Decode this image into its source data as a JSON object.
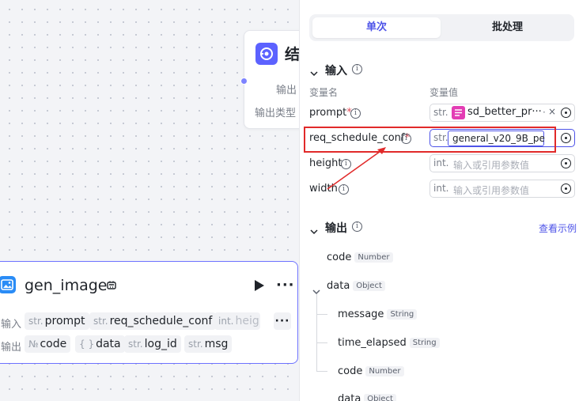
{
  "canvas": {
    "end_node": {
      "title": "结",
      "row1_label": "输出",
      "row2_label": "输出类型"
    },
    "gen_node": {
      "title": "gen_image",
      "more": "···",
      "input_label": "输入",
      "output_label": "输出",
      "inputs": [
        {
          "type": "str.",
          "name": "prompt"
        },
        {
          "type": "str.",
          "name": "req_schedule_conf"
        },
        {
          "type": "int.",
          "name": "heig"
        }
      ],
      "inputs_more": "···",
      "outputs": [
        {
          "type": "№",
          "name": "code"
        },
        {
          "type": "{ }",
          "name": "data"
        },
        {
          "type": "str.",
          "name": "log_id"
        },
        {
          "type": "str.",
          "name": "msg"
        }
      ]
    }
  },
  "panel": {
    "tabs": {
      "single": "单次",
      "batch": "批处理"
    },
    "input_section": {
      "title": "输入",
      "col_name": "变量名",
      "col_value": "变量值",
      "params": [
        {
          "name": "prompt",
          "required": "*",
          "type": "str.",
          "value_var": "sd_better_pr···"
        },
        {
          "name": "req_schedule_conf",
          "required": "*",
          "type": "str.",
          "value": "general_v20_9B_pe"
        },
        {
          "name": "height",
          "required": "",
          "type": "int.",
          "placeholder": "输入或引用参数值"
        },
        {
          "name": "width",
          "required": "",
          "type": "int.",
          "placeholder": "输入或引用参数值"
        }
      ],
      "chip_dot": "·",
      "chip_close": "×"
    },
    "output_section": {
      "title": "输出",
      "example_link": "查看示例",
      "fields": [
        {
          "name": "code",
          "type": "Number"
        },
        {
          "name": "data",
          "type": "Object"
        },
        {
          "name": "message",
          "type": "String"
        },
        {
          "name": "time_elapsed",
          "type": "String"
        },
        {
          "name": "code",
          "type": "Number"
        },
        {
          "name": "data",
          "type": "Object"
        }
      ]
    }
  },
  "colors": {
    "accent": "#4d53e8",
    "highlight": "#e12a2a",
    "node_icon": "#5c62ff",
    "image_icon": "#2a8cf6",
    "var_icon": "#e33db4"
  }
}
